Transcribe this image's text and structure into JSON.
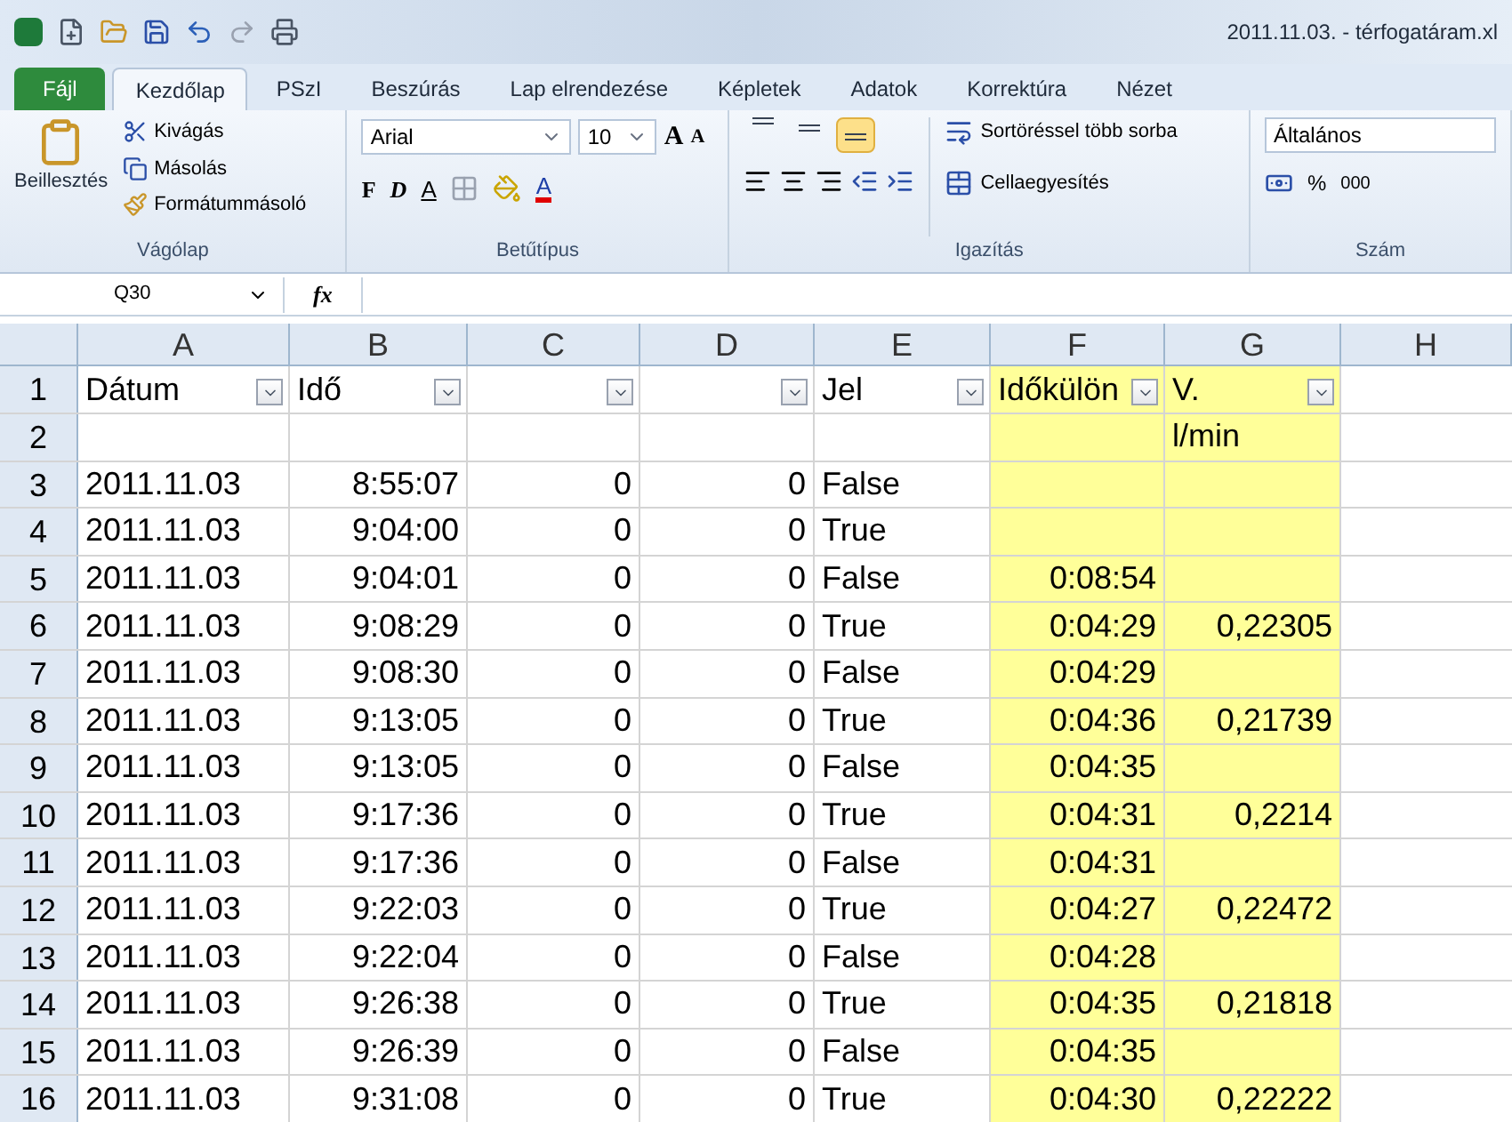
{
  "window": {
    "title": "2011.11.03. - térfogatáram.xl"
  },
  "tabs": [
    {
      "label": "Fájl",
      "kind": "file",
      "selected": false
    },
    {
      "label": "Kezdőlap",
      "kind": "tab",
      "selected": true
    },
    {
      "label": "PSzI",
      "kind": "tab",
      "selected": false
    },
    {
      "label": "Beszúrás",
      "kind": "tab",
      "selected": false
    },
    {
      "label": "Lap elrendezése",
      "kind": "tab",
      "selected": false
    },
    {
      "label": "Képletek",
      "kind": "tab",
      "selected": false
    },
    {
      "label": "Adatok",
      "kind": "tab",
      "selected": false
    },
    {
      "label": "Korrektúra",
      "kind": "tab",
      "selected": false
    },
    {
      "label": "Nézet",
      "kind": "tab",
      "selected": false
    }
  ],
  "clipboard": {
    "paste": "Beillesztés",
    "cut": "Kivágás",
    "copy": "Másolás",
    "painter": "Formátummásoló",
    "label": "Vágólap"
  },
  "font": {
    "name": "Arial",
    "size": "10",
    "grow": "A",
    "shrink": "A",
    "bold": "F",
    "italic": "D",
    "underline": "A",
    "text_colour_letter": "A",
    "label": "Betűtípus"
  },
  "alignment": {
    "wrap": "Sortöréssel több sorba",
    "merge": "Cellaegyesítés",
    "label": "Igazítás",
    "vertical": [
      {
        "selected": false
      },
      {
        "selected": false
      },
      {
        "selected": true
      }
    ]
  },
  "number": {
    "format": "Általános",
    "percent": "%",
    "thousands": "000",
    "label": "Szám"
  },
  "formula_bar": {
    "name_box": "Q30",
    "fx": "fx"
  },
  "columns": [
    "A",
    "B",
    "C",
    "D",
    "E",
    "F",
    "G",
    "H"
  ],
  "header_row": {
    "number": "1",
    "cells": [
      "Dátum",
      "Idő",
      "",
      "",
      "Jel",
      "Időkülön",
      "V."
    ]
  },
  "rows": [
    {
      "number": "2",
      "cells": [
        "",
        "",
        "",
        "",
        "",
        "",
        "l/min"
      ]
    },
    {
      "number": "3",
      "cells": [
        "2011.11.03",
        "8:55:07",
        "0",
        "0",
        "False",
        "",
        ""
      ]
    },
    {
      "number": "4",
      "cells": [
        "2011.11.03",
        "9:04:00",
        "0",
        "0",
        "True",
        "",
        ""
      ]
    },
    {
      "number": "5",
      "cells": [
        "2011.11.03",
        "9:04:01",
        "0",
        "0",
        "False",
        "0:08:54",
        ""
      ]
    },
    {
      "number": "6",
      "cells": [
        "2011.11.03",
        "9:08:29",
        "0",
        "0",
        "True",
        "0:04:29",
        "0,22305"
      ]
    },
    {
      "number": "7",
      "cells": [
        "2011.11.03",
        "9:08:30",
        "0",
        "0",
        "False",
        "0:04:29",
        ""
      ]
    },
    {
      "number": "8",
      "cells": [
        "2011.11.03",
        "9:13:05",
        "0",
        "0",
        "True",
        "0:04:36",
        "0,21739"
      ]
    },
    {
      "number": "9",
      "cells": [
        "2011.11.03",
        "9:13:05",
        "0",
        "0",
        "False",
        "0:04:35",
        ""
      ]
    },
    {
      "number": "10",
      "cells": [
        "2011.11.03",
        "9:17:36",
        "0",
        "0",
        "True",
        "0:04:31",
        "0,2214"
      ]
    },
    {
      "number": "11",
      "cells": [
        "2011.11.03",
        "9:17:36",
        "0",
        "0",
        "False",
        "0:04:31",
        ""
      ]
    },
    {
      "number": "12",
      "cells": [
        "2011.11.03",
        "9:22:03",
        "0",
        "0",
        "True",
        "0:04:27",
        "0,22472"
      ]
    },
    {
      "number": "13",
      "cells": [
        "2011.11.03",
        "9:22:04",
        "0",
        "0",
        "False",
        "0:04:28",
        ""
      ]
    },
    {
      "number": "14",
      "cells": [
        "2011.11.03",
        "9:26:38",
        "0",
        "0",
        "True",
        "0:04:35",
        "0,21818"
      ]
    },
    {
      "number": "15",
      "cells": [
        "2011.11.03",
        "9:26:39",
        "0",
        "0",
        "False",
        "0:04:35",
        ""
      ]
    },
    {
      "number": "16",
      "cells": [
        "2011.11.03",
        "9:31:08",
        "0",
        "0",
        "True",
        "0:04:30",
        "0,22222"
      ]
    }
  ]
}
